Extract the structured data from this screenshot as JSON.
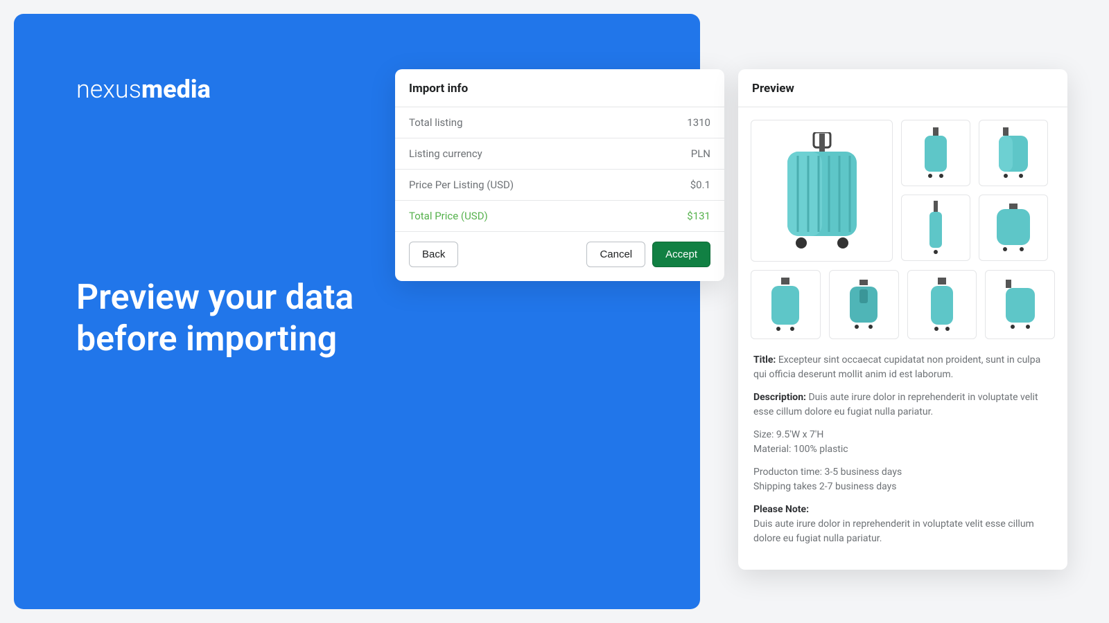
{
  "logo": {
    "thin": "nexus",
    "bold": "media"
  },
  "headline": "Preview your data\nbefore importing",
  "import": {
    "title": "Import info",
    "rows": [
      {
        "label": "Total listing",
        "value": "1310"
      },
      {
        "label": "Listing currency",
        "value": "PLN"
      },
      {
        "label": "Price Per Listing (USD)",
        "value": "$0.1"
      }
    ],
    "total": {
      "label": "Total Price (USD)",
      "value": "$131"
    },
    "buttons": {
      "back": "Back",
      "cancel": "Cancel",
      "accept": "Accept"
    }
  },
  "preview": {
    "title": "Preview",
    "title_label": "Title:",
    "title_text": "Excepteur sint occaecat cupidatat non proident, sunt in culpa qui officia deserunt mollit anim id est laborum.",
    "desc_label": "Description:",
    "desc_text": "Duis aute irure dolor in reprehenderit in voluptate velit esse cillum dolore eu fugiat nulla pariatur.",
    "size": "Size: 9.5'W x 7'H",
    "material": "Material: 100% plastic",
    "production": "Producton time: 3-5 business days",
    "shipping": "Shipping takes 2-7 business days",
    "note_label": "Please Note:",
    "note_text": "Duis aute irure dolor in reprehenderit in voluptate velit esse cillum dolore eu fugiat nulla pariatur."
  }
}
